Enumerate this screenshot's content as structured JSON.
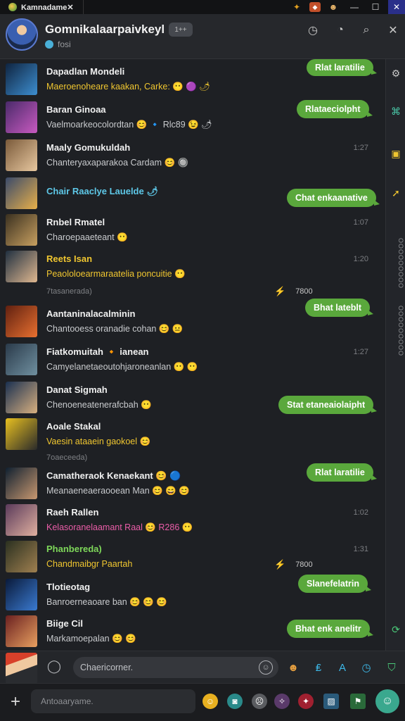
{
  "window": {
    "title": "Kamnadame✕",
    "controls": [
      "minimize-icon",
      "maximize-icon",
      "close-icon"
    ],
    "control_glyphs": [
      "—",
      "☐",
      "✕"
    ]
  },
  "header": {
    "title": "Gomnikalaarpaivkeyl",
    "chip": "1++",
    "subtitle": "fosi"
  },
  "chats": [
    {
      "name": "Dapadlan Mondeli",
      "message": "Maeroenoheare kaakan, Carke: 😶 🟣 🌶",
      "time": "",
      "pill": "Rlat laratilie",
      "msg_style": "yellow",
      "name_style": "",
      "avatar": [
        "#0f2440",
        "#3d8ed0"
      ]
    },
    {
      "name": "Baran Ginoaa",
      "message": "Vaelmoarkeocolordtan 😊 🔹 Rlc89 😉 🌶",
      "time": "",
      "pill": "Rlataeciolpht",
      "msg_style": "",
      "name_style": "",
      "avatar": [
        "#4a2a6a",
        "#c85ac0"
      ]
    },
    {
      "name": "Maaly Gomukuldah",
      "message": "Chanteryaxaparakoa Cardam 😊 🔘",
      "time": "1:27",
      "pill": "",
      "msg_style": "",
      "name_style": "",
      "avatar": [
        "#7a5a3a",
        "#e8c8a0"
      ]
    },
    {
      "name": "Chair Raaclye Lauelde 🌶",
      "message": "",
      "time": "",
      "pill": "Chat enkaanative",
      "msg_style": "",
      "name_style": "cyan",
      "avatar": [
        "#3a4a6a",
        "#e8b04a"
      ]
    },
    {
      "name": "Rnbel Rmatel",
      "message": "Charoepaaeteant 😶",
      "time": "1:07",
      "pill": "",
      "msg_style": "",
      "name_style": "",
      "avatar": [
        "#3a3020",
        "#c8a060"
      ]
    },
    {
      "name": "Reets Isan",
      "message": "Peaololoearmaraatelia poncuitie 😶",
      "time": "1:20",
      "pill": "",
      "msg_style": "yellow",
      "name_style": "yellow",
      "avatar": [
        "#203040",
        "#e0b890"
      ]
    },
    {
      "name": "Aantaninalacalminin",
      "message": "Chantooess oranadie cohan 😊 😐",
      "time": "",
      "pill": "Bhat lateblt",
      "msg_style": "",
      "name_style": "",
      "avatar": [
        "#602010",
        "#e87030"
      ]
    },
    {
      "name": "Fiatkomuitah 🔸 ianean",
      "message": "Camyelanetaeoutohjaroneanlan 😶 😶",
      "time": "1:27",
      "pill": "",
      "msg_style": "",
      "name_style": "",
      "avatar": [
        "#2a3a4a",
        "#7090a0"
      ]
    },
    {
      "name": "Danat Sigmah",
      "message": "Chenoeneatenerafcbah 😶",
      "time": "",
      "pill": "Stat etaneaiolaipht",
      "msg_style": "",
      "name_style": "",
      "avatar": [
        "#1a3050",
        "#d8b080"
      ]
    },
    {
      "name": "Aoale Stakal",
      "message": "Vaesin ataaein gaokoel 😊",
      "time": "",
      "pill": "",
      "msg_style": "yellow",
      "name_style": "",
      "avatar": [
        "#e8c020",
        "#2a2a2a"
      ]
    },
    {
      "name": "Camatheraok Kenaekant 😊 🔵",
      "message": "Meanaeneaeraooean Man 😊 😄 😊",
      "time": "",
      "pill": "Rlat laratilie",
      "msg_style": "",
      "name_style": "",
      "avatar": [
        "#102030",
        "#c89870"
      ]
    },
    {
      "name": "Raeh Rallen",
      "message": "Kelasoranelaamant Raal 😊 R286 😶",
      "time": "1:02",
      "pill": "",
      "msg_style": "pink",
      "name_style": "",
      "avatar": [
        "#5a3a5a",
        "#e0b0a0"
      ]
    },
    {
      "name": "Phanbereda)",
      "message": "Chandmaibgr Paartah",
      "time": "1:31",
      "pill": "",
      "msg_style": "yellow",
      "name_style": "green",
      "avatar": [
        "#2a3020",
        "#a08050"
      ]
    },
    {
      "name": "Tlotieotag",
      "message": "Banroerneaoare ban 😊 😊 😊",
      "time": "",
      "pill": "Slanefelatrin",
      "msg_style": "",
      "name_style": "",
      "avatar": [
        "#0a1a3a",
        "#3a7ad0"
      ]
    },
    {
      "name": "Biige Cil",
      "message": "Markamoepalan 😊 😊",
      "time": "",
      "pill": "Bhat enk anelitr",
      "msg_style": "",
      "name_style": "",
      "avatar": [
        "#6a2020",
        "#e8a060"
      ]
    }
  ],
  "system_rows": [
    {
      "text": "7tasanerada)",
      "right": "7800"
    },
    {
      "text": "7oaeceeda)",
      "right": ""
    },
    {
      "text": "",
      "right": "7800"
    }
  ],
  "composer": {
    "placeholder": "Chaericorner.",
    "emoji_glyph": "☺"
  },
  "bottombar": {
    "placeholder": "Antoaaryame.",
    "icons": [
      "smile-icon",
      "camera-icon",
      "sticker-icon",
      "spark-icon",
      "star-icon",
      "image-icon",
      "gift-icon",
      "user-icon"
    ]
  },
  "rail": {
    "vtext1": "OOOOOOOOO",
    "vtext2": "OOOOOOOOO"
  },
  "colors": {
    "pill": "#5aa83c",
    "accent_blue": "#3db8e8",
    "accent_yellow": "#f0c630"
  }
}
